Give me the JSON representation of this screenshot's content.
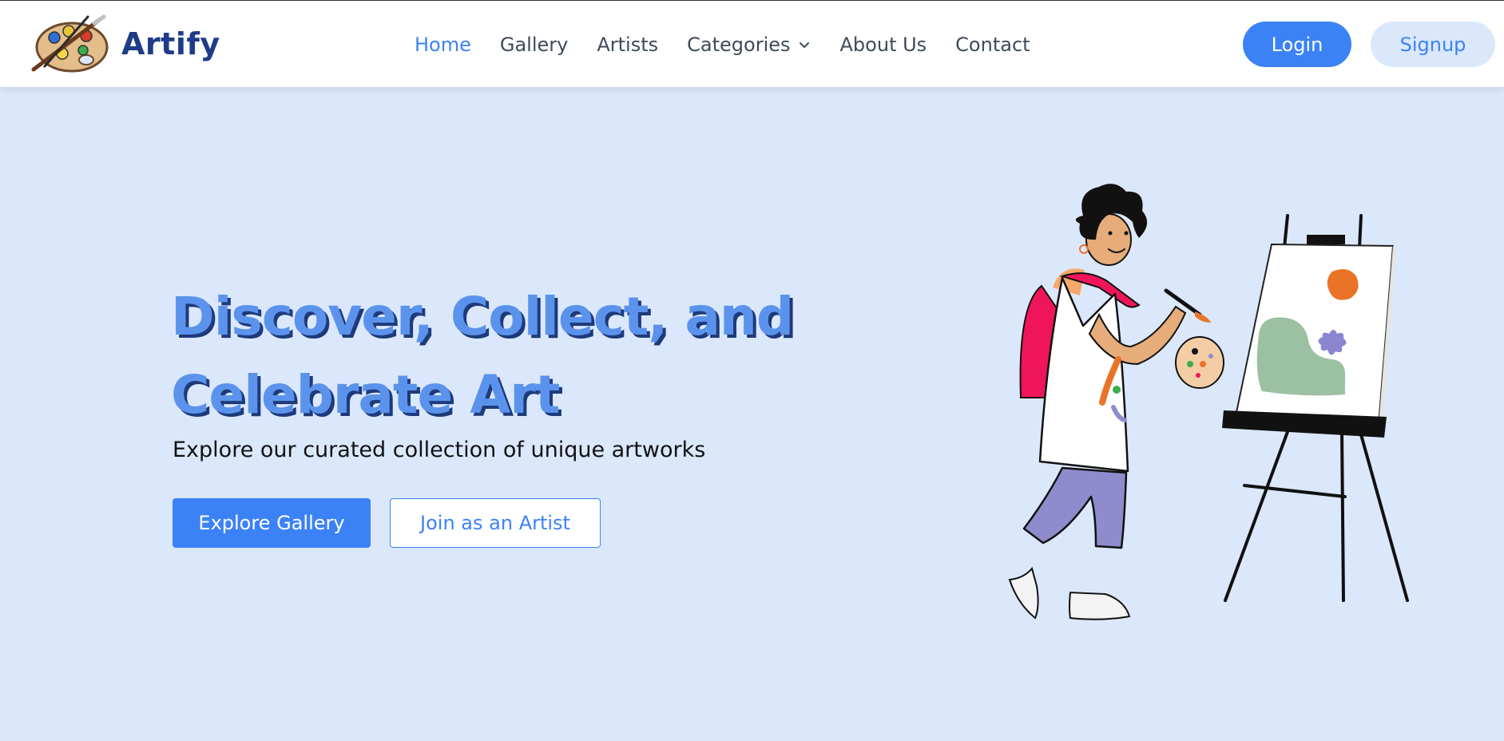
{
  "brand": {
    "name": "Artify",
    "logo_icon": "paint-palette-icon"
  },
  "nav": {
    "links": [
      {
        "label": "Home",
        "active": true
      },
      {
        "label": "Gallery",
        "active": false
      },
      {
        "label": "Artists",
        "active": false
      },
      {
        "label": "Categories",
        "active": false,
        "icon": "chevron-down-icon"
      },
      {
        "label": "About Us",
        "active": false
      },
      {
        "label": "Contact",
        "active": false
      }
    ],
    "login_label": "Login",
    "signup_label": "Signup"
  },
  "hero": {
    "title_line1": "Discover, Collect, and",
    "title_line2": "Celebrate Art",
    "subtitle": "Explore our curated collection of unique artworks",
    "primary_cta": "Explore Gallery",
    "secondary_cta": "Join as an Artist",
    "illustration": "woman-painting-at-easel"
  },
  "colors": {
    "accent": "#3b82f6",
    "brand_text": "#1f3c88",
    "hero_background": "#dbe8fc",
    "title_fill": "#5b93ec",
    "title_shadow": "#1e3a7a"
  }
}
